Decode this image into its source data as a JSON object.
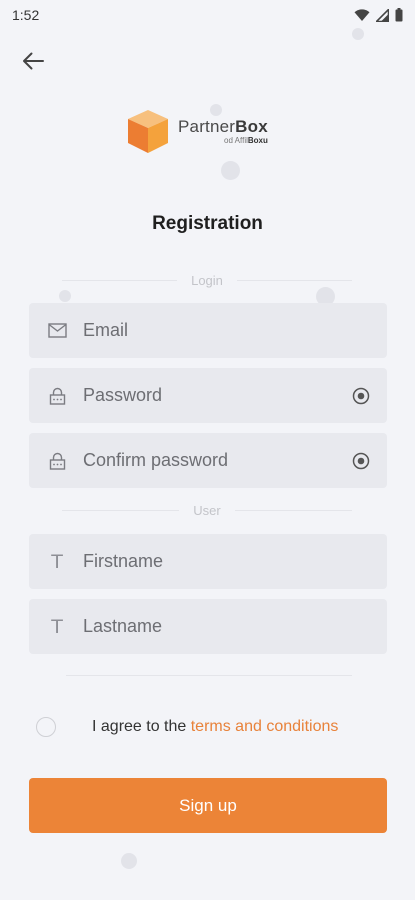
{
  "status_bar": {
    "time": "1:52"
  },
  "logo": {
    "name_light": "Partner",
    "name_bold": "Box",
    "sub_light": "od Affil",
    "sub_bold": "Boxu"
  },
  "page_title": "Registration",
  "sections": {
    "login_label": "Login",
    "user_label": "User"
  },
  "fields": {
    "email_placeholder": "Email",
    "password_placeholder": "Password",
    "confirm_password_placeholder": "Confirm password",
    "firstname_placeholder": "Firstname",
    "lastname_placeholder": "Lastname"
  },
  "agree": {
    "text": "I agree to the ",
    "link": "terms and conditions"
  },
  "signup_label": "Sign up",
  "colors": {
    "accent": "#ec8437",
    "link": "#e8823a",
    "background": "#f3f4f8",
    "field_bg": "#e8e9ee"
  },
  "icons": {
    "back": "arrow-left-icon",
    "email": "mail-icon",
    "password": "lock-icon",
    "visibility": "eye-icon",
    "text": "text-t-icon"
  }
}
